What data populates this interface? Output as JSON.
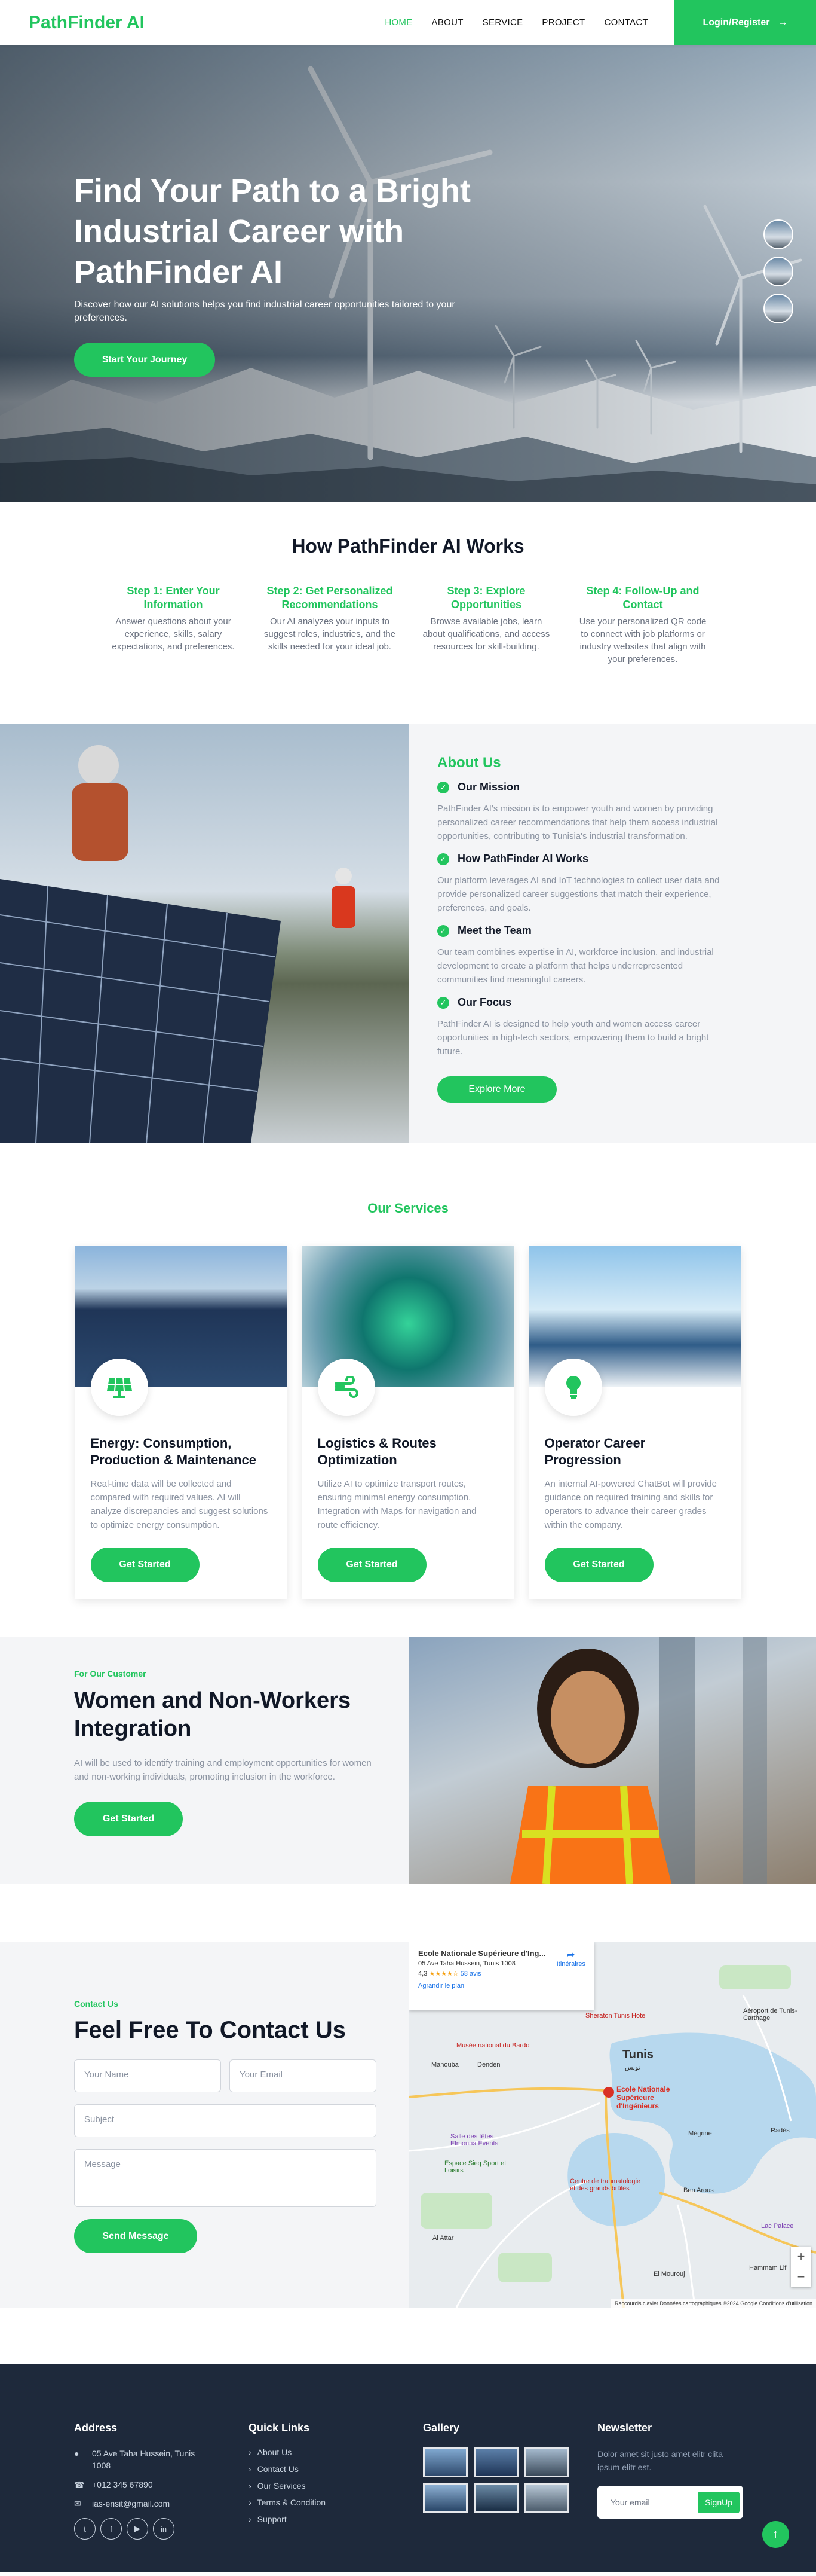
{
  "nav": {
    "logo": "PathFinder AI",
    "items": [
      "HOME",
      "ABOUT",
      "SERVICE",
      "PROJECT",
      "CONTACT"
    ],
    "active": "HOME",
    "login": "Login/Register",
    "login_icon": "arrow-right-icon"
  },
  "hero": {
    "title": "Find Your Path to a Bright Industrial Career with PathFinder AI",
    "subtitle": "Discover how our AI solutions helps you find industrial career opportunities tailored to your preferences.",
    "cta": "Start Your Journey"
  },
  "how": {
    "title": "How PathFinder AI Works",
    "steps": [
      {
        "title": "Step 1: Enter Your Information",
        "text": "Answer questions about your experience, skills, salary expectations, and preferences."
      },
      {
        "title": "Step 2: Get Personalized Recommendations",
        "text": "Our AI analyzes your inputs to suggest roles, industries, and the skills needed for your ideal job."
      },
      {
        "title": "Step 3: Explore Opportunities",
        "text": "Browse available jobs, learn about qualifications, and access resources for skill-building."
      },
      {
        "title": "Step 4: Follow-Up and Contact",
        "text": "Use your personalized QR code to connect with job platforms or industry websites that align with your preferences."
      }
    ]
  },
  "about": {
    "title": "About Us",
    "items": [
      {
        "heading": "Our Mission",
        "text": "PathFinder AI's mission is to empower youth and women by providing personalized career recommendations that help them access industrial opportunities, contributing to Tunisia's industrial transformation."
      },
      {
        "heading": "How PathFinder AI Works",
        "text": "Our platform leverages AI and IoT technologies to collect user data and provide personalized career suggestions that match their experience, preferences, and goals."
      },
      {
        "heading": "Meet the Team",
        "text": "Our team combines expertise in AI, workforce inclusion, and industrial development to create a platform that helps underrepresented communities find meaningful careers."
      },
      {
        "heading": "Our Focus",
        "text": "PathFinder AI is designed to help youth and women access career opportunities in high-tech sectors, empowering them to build a bright future."
      }
    ],
    "button": "Explore More"
  },
  "services": {
    "title": "Our Services",
    "cards": [
      {
        "icon": "solar-panel-icon",
        "title": "Energy: Consumption, Production & Maintenance",
        "text": "Real-time data will be collected and compared with required values. AI will analyze discrepancies and suggest solutions to optimize energy consumption.",
        "button": "Get Started"
      },
      {
        "icon": "wind-icon",
        "title": "Logistics & Routes Optimization",
        "text": "Utilize AI to optimize transport routes, ensuring minimal energy consumption. Integration with Maps for navigation and route efficiency.",
        "button": "Get Started"
      },
      {
        "icon": "lightbulb-icon",
        "title": "Operator Career Progression",
        "text": "An internal AI-powered ChatBot will provide guidance on required training and skills for operators to advance their career grades within the company.",
        "button": "Get Started"
      }
    ]
  },
  "women": {
    "eyebrow": "For Our Customer",
    "title": "Women and Non-Workers Integration",
    "text": "AI will be used to identify training and employment opportunities for women and non-working individuals, promoting inclusion in the workforce.",
    "button": "Get Started"
  },
  "contact": {
    "eyebrow": "Contact Us",
    "title": "Feel Free To Contact Us",
    "placeholders": {
      "name": "Your Name",
      "email": "Your Email",
      "subject": "Subject",
      "message": "Message"
    },
    "button": "Send Message"
  },
  "map": {
    "place": "Ecole Nationale Supérieure d'Ing...",
    "address": "05 Ave Taha Hussein, Tunis 1008",
    "rating": "4,3",
    "stars": "★★★★☆",
    "reviews": "58 avis",
    "enlarge": "Agrandir le plan",
    "directions": "Itinéraires",
    "labels": {
      "tunis": "Tunis",
      "tunis_ar": "تونس",
      "manouba": "Manouba",
      "denden": "Denden",
      "school": "Ecole Nationale Supérieure d'Ingénieurs",
      "museum": "Musée national du Bardo",
      "sheraton": "Sheraton Tunis Hotel",
      "carthage": "Aéroport de Tunis-Carthage",
      "rades": "Radès",
      "megrine": "Mégrine",
      "benarous": "Ben Arous",
      "mourouj": "El Mourouj",
      "attar": "Al Attar",
      "salle": "Salle des fêtes Elmouna Events",
      "espace": "Espace Sieq Sport et Loisirs",
      "centre": "Centre de traumatologie et des grands brûlés",
      "hammam": "Hammam Lif",
      "lacfarace": "Lac Palace"
    },
    "footer": "Raccourcis clavier   Données cartographiques ©2024 Google   Conditions d'utilisation"
  },
  "footer": {
    "address_title": "Address",
    "address": "05 Ave Taha Hussein, Tunis 1008",
    "phone": "+012 345 67890",
    "email": "ias-ensit@gmail.com",
    "socials": [
      "twitter-icon",
      "facebook-icon",
      "youtube-icon",
      "linkedin-icon"
    ],
    "links_title": "Quick Links",
    "links": [
      "About Us",
      "Contact Us",
      "Our Services",
      "Terms & Condition",
      "Support"
    ],
    "gallery_title": "Gallery",
    "newsletter_title": "Newsletter",
    "newsletter_text": "Dolor amet sit justo amet elitr clita ipsum elitr est.",
    "newsletter_placeholder": "Your email",
    "newsletter_button": "SignUp"
  },
  "colors": {
    "accent": "#22c55e",
    "footer_bg": "#1e293b"
  }
}
